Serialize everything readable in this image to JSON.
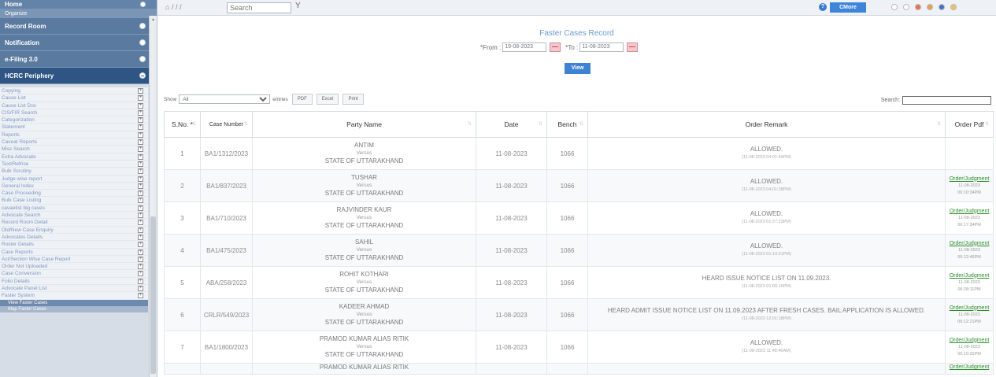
{
  "sidebar": {
    "headers": [
      {
        "label": "Home",
        "style": "top"
      },
      {
        "label": "Organize",
        "style": "sub"
      },
      {
        "label": "Record Room",
        "style": "normal"
      },
      {
        "label": "Notification",
        "style": "normal"
      },
      {
        "label": "e-Filing 3.0",
        "style": "normal"
      },
      {
        "label": "HCRC Periphery",
        "style": "active"
      }
    ],
    "items": [
      "Copying",
      "Cause List",
      "Cause List Doc",
      "CIS/FIR Search",
      "Categorization",
      "Statement",
      "Reports",
      "Caveat Reports",
      "Misc Search",
      "Extra Advocate",
      "Text/Refrise",
      "Bulk Scrutiny",
      "Judge wise report",
      "General Index",
      "Case Proceeding",
      "Bulk Case Listing",
      "cavaetist big cases",
      "Advocate Search",
      "Record Room Detail",
      "Old/New Case Enquiry",
      "Advocates Details",
      "Roster Details",
      "Case Reports",
      "Act/Section Wise Case Report",
      "Order Not Uploaded",
      "Case Conversion",
      "Folio Details",
      "Advocate Panel List",
      "Faster System"
    ],
    "subitems": [
      "View Faster Cases",
      "Map Faster Cases"
    ]
  },
  "topbar": {
    "home_path": "/ / /",
    "search_placeholder": "Search",
    "cmore_label": "CMore",
    "theme_colors": [
      "#ffffff",
      "#ffffff",
      "#e8734a",
      "#e8a04a",
      "#4a6fc0",
      "#f0c060"
    ]
  },
  "form": {
    "title": "Faster Cases Record",
    "from_label": "*From :",
    "from_value": "19-08-2023",
    "to_label": "*To :",
    "to_value": "11-08-2023",
    "view_label": "View"
  },
  "controls": {
    "show_label": "Show",
    "show_value": "All",
    "entries_label": "entries",
    "pdf_label": "PDF",
    "excel_label": "Excel",
    "print_label": "Print",
    "search_label": "Search:"
  },
  "table": {
    "headers": [
      "S.No.",
      "Case Number",
      "Party Name",
      "Date",
      "Bench",
      "Order Remark",
      "Order Pdf"
    ],
    "versus": "Versus",
    "rows": [
      {
        "sno": "1",
        "case": "BA1/1312/2023",
        "p1": "ANTIM",
        "p2": "STATE OF UTTARAKHAND",
        "date": "11-08-2023",
        "bench": "1066",
        "remark": "ALLOWED.",
        "ts": "(11-08-2023 04:01:44PM)",
        "pdf": "",
        "pdf_date": "",
        "pdf_time": ""
      },
      {
        "sno": "2",
        "case": "BA1/837/2023",
        "p1": "TUSHAR",
        "p2": "STATE OF UTTARAKHAND",
        "date": "11-08-2023",
        "bench": "1066",
        "remark": "ALLOWED.",
        "ts": "(11-08-2023 04:01:28PM)",
        "pdf": "Order/Judgment",
        "pdf_date": "11-08-2023",
        "pdf_time": "06:10:34PM"
      },
      {
        "sno": "3",
        "case": "BA1/710/2023",
        "p1": "RAJVINDER KAUR",
        "p2": "STATE OF UTTARAKHAND",
        "date": "11-08-2023",
        "bench": "1066",
        "remark": "ALLOWED.",
        "ts": "(11-08-2023 01:27:23PM)",
        "pdf": "Order/Judgment",
        "pdf_date": "11-08-2023",
        "pdf_time": "06:17:34PM"
      },
      {
        "sno": "4",
        "case": "BA1/475/2023",
        "p1": "SAHIL",
        "p2": "STATE OF UTTARAKHAND",
        "date": "11-08-2023",
        "bench": "1066",
        "remark": "ALLOWED.",
        "ts": "(11-08-2023 01:10:51PM)",
        "pdf": "Order/Judgment",
        "pdf_date": "11-08-2023",
        "pdf_time": "06:12:46PM"
      },
      {
        "sno": "5",
        "case": "ABA/258/2023",
        "p1": "ROHIT KOTHARI",
        "p2": "STATE OF UTTARAKHAND",
        "date": "11-08-2023",
        "bench": "1066",
        "remark": "HEARD ISSUE NOTICE LIST ON 11.09.2023.",
        "ts": "(11-08-2023 01:00:16PM)",
        "pdf": "Order/Judgment",
        "pdf_date": "11-08-2023",
        "pdf_time": "06:28:11PM"
      },
      {
        "sno": "6",
        "case": "CRLR/549/2023",
        "p1": "KADEER AHMAD",
        "p2": "STATE OF UTTARAKHAND",
        "date": "11-08-2023",
        "bench": "1066",
        "remark": "HEARD ADMIT ISSUE NOTICE LIST ON 11.09.2023 AFTER FRESH CASES. BAIL APPLICATION IS ALLOWED.",
        "ts": "(11-08-2023 12:01:18PM)",
        "pdf": "Order/Judgment",
        "pdf_date": "11-08-2023",
        "pdf_time": "06:12:21PM"
      },
      {
        "sno": "7",
        "case": "BA1/1800/2023",
        "p1": "PRAMOD KUMAR ALIAS RITIK",
        "p2": "STATE OF UTTARAKHAND",
        "date": "11-08-2023",
        "bench": "1066",
        "remark": "ALLOWED.",
        "ts": "(11-08-2023 11:48:46AM)",
        "pdf": "Order/Judgment",
        "pdf_date": "11-08-2023",
        "pdf_time": "06:10:31PM"
      }
    ],
    "partial_row": {
      "p1": "PRAMOD KUMAR ALIAS RITIK",
      "pdf": "Order/Judgment"
    }
  }
}
